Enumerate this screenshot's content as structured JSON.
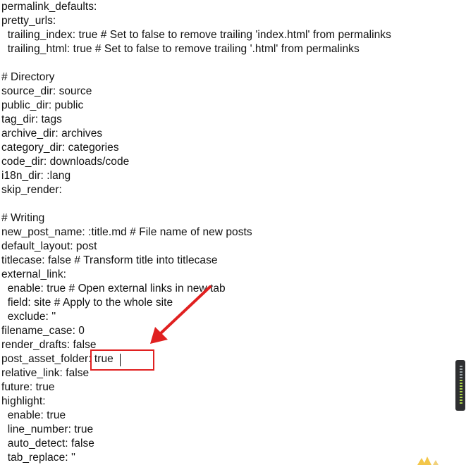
{
  "editor": {
    "lines": [
      "permalink_defaults:",
      "pretty_urls:",
      "  trailing_index: true # Set to false to remove trailing 'index.html' from permalinks",
      "  trailing_html: true # Set to false to remove trailing '.html' from permalinks",
      "",
      "# Directory",
      "source_dir: source",
      "public_dir: public",
      "tag_dir: tags",
      "archive_dir: archives",
      "category_dir: categories",
      "code_dir: downloads/code",
      "i18n_dir: :lang",
      "skip_render:",
      "",
      "# Writing",
      "new_post_name: :title.md # File name of new posts",
      "default_layout: post",
      "titlecase: false # Transform title into titlecase",
      "external_link:",
      "  enable: true # Open external links in new tab",
      "  field: site # Apply to the whole site",
      "  exclude: ''",
      "filename_case: 0",
      "render_drafts: false",
      "post_asset_folder: true",
      "relative_link: false",
      "future: true",
      "highlight:",
      "  enable: true",
      "  line_number: true",
      "  auto_detect: false",
      "  tab_replace: ''"
    ]
  },
  "annotation": {
    "color": "#e02020",
    "highlighted_setting": "post_asset_folder"
  },
  "colors": {
    "text": "#111111",
    "background": "#ffffff",
    "scroll_widget": "#2e2f31",
    "indicator_lit": "#a8d04a"
  }
}
